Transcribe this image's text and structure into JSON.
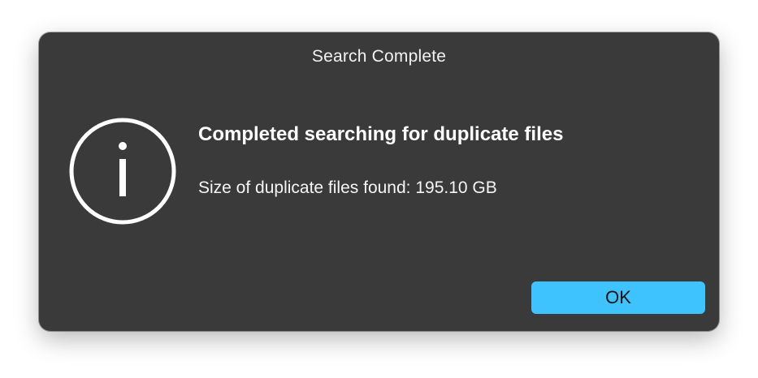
{
  "dialog": {
    "title": "Search Complete",
    "icon": "info-icon",
    "heading": "Completed searching for duplicate files",
    "message": "Size of duplicate files found: 195.10 GB",
    "ok_label": "OK"
  },
  "colors": {
    "dialog_background": "#3a3a3a",
    "text": "#ffffff",
    "button_accent": "#3fc3ff"
  }
}
